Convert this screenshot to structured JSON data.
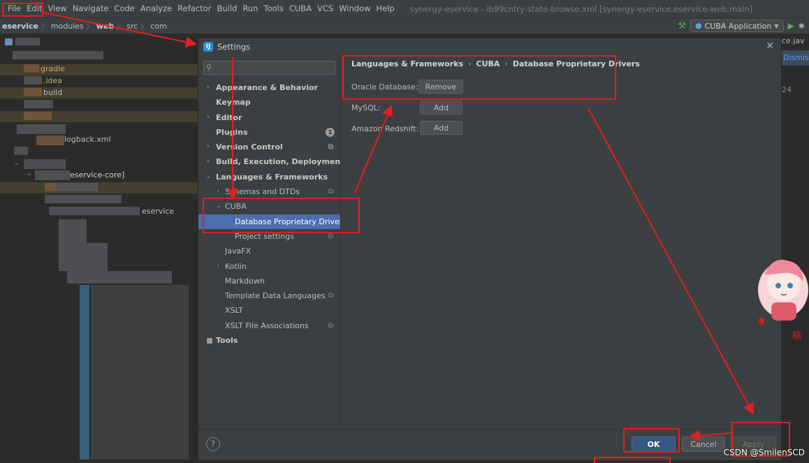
{
  "menubar": {
    "items": [
      "File",
      "Edit",
      "View",
      "Navigate",
      "Code",
      "Analyze",
      "Refactor",
      "Build",
      "Run",
      "Tools",
      "CUBA",
      "VCS",
      "Window",
      "Help"
    ],
    "title": "synergy-eservice - ib99cntry-state-browse.xml [synergy-eservice.eservice-web.main]"
  },
  "navbar": {
    "crumbs": [
      "eservice",
      "modules",
      "web",
      "src",
      "com"
    ],
    "run_config": "CUBA Application"
  },
  "project_tree": {
    "rows": [
      "gradle",
      ".idea",
      "build",
      "logback.xml",
      "eservice-core]",
      "eservice"
    ]
  },
  "editor": {
    "tab_fragment": "ce.jav",
    "dismiss": "Dismiss",
    "line_number": "24"
  },
  "dialog": {
    "title": "Settings",
    "search_placeholder": "",
    "nav": [
      {
        "label": "Appearance & Behavior",
        "bold": true,
        "arrow": "right"
      },
      {
        "label": "Keymap",
        "bold": true
      },
      {
        "label": "Editor",
        "bold": true,
        "arrow": "right"
      },
      {
        "label": "Plugins",
        "bold": true,
        "badge": "1"
      },
      {
        "label": "Version Control",
        "bold": true,
        "arrow": "right",
        "copy": true
      },
      {
        "label": "Build, Execution, Deployment",
        "bold": true,
        "arrow": "right"
      },
      {
        "label": "Languages & Frameworks",
        "bold": true,
        "arrow": "down"
      },
      {
        "label": "Schemas and DTDs",
        "arrow": "right",
        "copy": true
      },
      {
        "label": "CUBA",
        "arrow": "down"
      },
      {
        "label": "Database Proprietary Drivers",
        "selected": true
      },
      {
        "label": "Project settings",
        "copy": true
      },
      {
        "label": "JavaFX"
      },
      {
        "label": "Kotlin",
        "arrow": "right"
      },
      {
        "label": "Markdown"
      },
      {
        "label": "Template Data Languages",
        "copy": true
      },
      {
        "label": "XSLT"
      },
      {
        "label": "XSLT File Associations",
        "copy": true
      },
      {
        "label": "Tools",
        "bold": true
      }
    ],
    "breadcrumb": [
      "Languages & Frameworks",
      "CUBA",
      "Database Proprietary Drivers"
    ],
    "drivers": [
      {
        "label": "Oracle Database:",
        "button": "Remove"
      },
      {
        "label": "MySQL:",
        "button": "Add"
      },
      {
        "label": "Amazon Redshift:",
        "button": "Add"
      }
    ],
    "footer": {
      "help": "?",
      "ok": "OK",
      "cancel": "Cancel",
      "apply": "Apply"
    }
  },
  "watermark": "CSDN @SmilenSCD",
  "colors": {
    "annotation_red": "#e02020",
    "selection": "#4b6eaf",
    "ok_button": "#365880"
  }
}
